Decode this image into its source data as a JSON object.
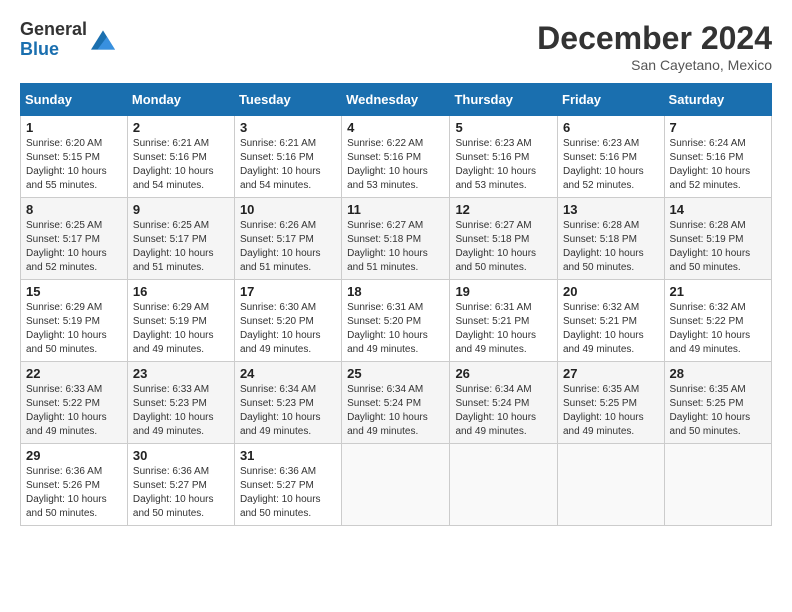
{
  "header": {
    "logo_line1": "General",
    "logo_line2": "Blue",
    "month_title": "December 2024",
    "location": "San Cayetano, Mexico"
  },
  "calendar": {
    "days_of_week": [
      "Sunday",
      "Monday",
      "Tuesday",
      "Wednesday",
      "Thursday",
      "Friday",
      "Saturday"
    ],
    "weeks": [
      [
        null,
        {
          "day": 2,
          "sunrise": "6:21 AM",
          "sunset": "5:16 PM",
          "daylight": "10 hours and 54 minutes."
        },
        {
          "day": 3,
          "sunrise": "6:21 AM",
          "sunset": "5:16 PM",
          "daylight": "10 hours and 54 minutes."
        },
        {
          "day": 4,
          "sunrise": "6:22 AM",
          "sunset": "5:16 PM",
          "daylight": "10 hours and 53 minutes."
        },
        {
          "day": 5,
          "sunrise": "6:23 AM",
          "sunset": "5:16 PM",
          "daylight": "10 hours and 53 minutes."
        },
        {
          "day": 6,
          "sunrise": "6:23 AM",
          "sunset": "5:16 PM",
          "daylight": "10 hours and 52 minutes."
        },
        {
          "day": 7,
          "sunrise": "6:24 AM",
          "sunset": "5:16 PM",
          "daylight": "10 hours and 52 minutes."
        }
      ],
      [
        {
          "day": 1,
          "sunrise": "6:20 AM",
          "sunset": "5:15 PM",
          "daylight": "10 hours and 55 minutes."
        },
        null,
        null,
        null,
        null,
        null,
        null
      ],
      [
        {
          "day": 8,
          "sunrise": "6:25 AM",
          "sunset": "5:17 PM",
          "daylight": "10 hours and 52 minutes."
        },
        {
          "day": 9,
          "sunrise": "6:25 AM",
          "sunset": "5:17 PM",
          "daylight": "10 hours and 51 minutes."
        },
        {
          "day": 10,
          "sunrise": "6:26 AM",
          "sunset": "5:17 PM",
          "daylight": "10 hours and 51 minutes."
        },
        {
          "day": 11,
          "sunrise": "6:27 AM",
          "sunset": "5:18 PM",
          "daylight": "10 hours and 51 minutes."
        },
        {
          "day": 12,
          "sunrise": "6:27 AM",
          "sunset": "5:18 PM",
          "daylight": "10 hours and 50 minutes."
        },
        {
          "day": 13,
          "sunrise": "6:28 AM",
          "sunset": "5:18 PM",
          "daylight": "10 hours and 50 minutes."
        },
        {
          "day": 14,
          "sunrise": "6:28 AM",
          "sunset": "5:19 PM",
          "daylight": "10 hours and 50 minutes."
        }
      ],
      [
        {
          "day": 15,
          "sunrise": "6:29 AM",
          "sunset": "5:19 PM",
          "daylight": "10 hours and 50 minutes."
        },
        {
          "day": 16,
          "sunrise": "6:29 AM",
          "sunset": "5:19 PM",
          "daylight": "10 hours and 49 minutes."
        },
        {
          "day": 17,
          "sunrise": "6:30 AM",
          "sunset": "5:20 PM",
          "daylight": "10 hours and 49 minutes."
        },
        {
          "day": 18,
          "sunrise": "6:31 AM",
          "sunset": "5:20 PM",
          "daylight": "10 hours and 49 minutes."
        },
        {
          "day": 19,
          "sunrise": "6:31 AM",
          "sunset": "5:21 PM",
          "daylight": "10 hours and 49 minutes."
        },
        {
          "day": 20,
          "sunrise": "6:32 AM",
          "sunset": "5:21 PM",
          "daylight": "10 hours and 49 minutes."
        },
        {
          "day": 21,
          "sunrise": "6:32 AM",
          "sunset": "5:22 PM",
          "daylight": "10 hours and 49 minutes."
        }
      ],
      [
        {
          "day": 22,
          "sunrise": "6:33 AM",
          "sunset": "5:22 PM",
          "daylight": "10 hours and 49 minutes."
        },
        {
          "day": 23,
          "sunrise": "6:33 AM",
          "sunset": "5:23 PM",
          "daylight": "10 hours and 49 minutes."
        },
        {
          "day": 24,
          "sunrise": "6:34 AM",
          "sunset": "5:23 PM",
          "daylight": "10 hours and 49 minutes."
        },
        {
          "day": 25,
          "sunrise": "6:34 AM",
          "sunset": "5:24 PM",
          "daylight": "10 hours and 49 minutes."
        },
        {
          "day": 26,
          "sunrise": "6:34 AM",
          "sunset": "5:24 PM",
          "daylight": "10 hours and 49 minutes."
        },
        {
          "day": 27,
          "sunrise": "6:35 AM",
          "sunset": "5:25 PM",
          "daylight": "10 hours and 49 minutes."
        },
        {
          "day": 28,
          "sunrise": "6:35 AM",
          "sunset": "5:25 PM",
          "daylight": "10 hours and 50 minutes."
        }
      ],
      [
        {
          "day": 29,
          "sunrise": "6:36 AM",
          "sunset": "5:26 PM",
          "daylight": "10 hours and 50 minutes."
        },
        {
          "day": 30,
          "sunrise": "6:36 AM",
          "sunset": "5:27 PM",
          "daylight": "10 hours and 50 minutes."
        },
        {
          "day": 31,
          "sunrise": "6:36 AM",
          "sunset": "5:27 PM",
          "daylight": "10 hours and 50 minutes."
        },
        null,
        null,
        null,
        null
      ]
    ]
  }
}
